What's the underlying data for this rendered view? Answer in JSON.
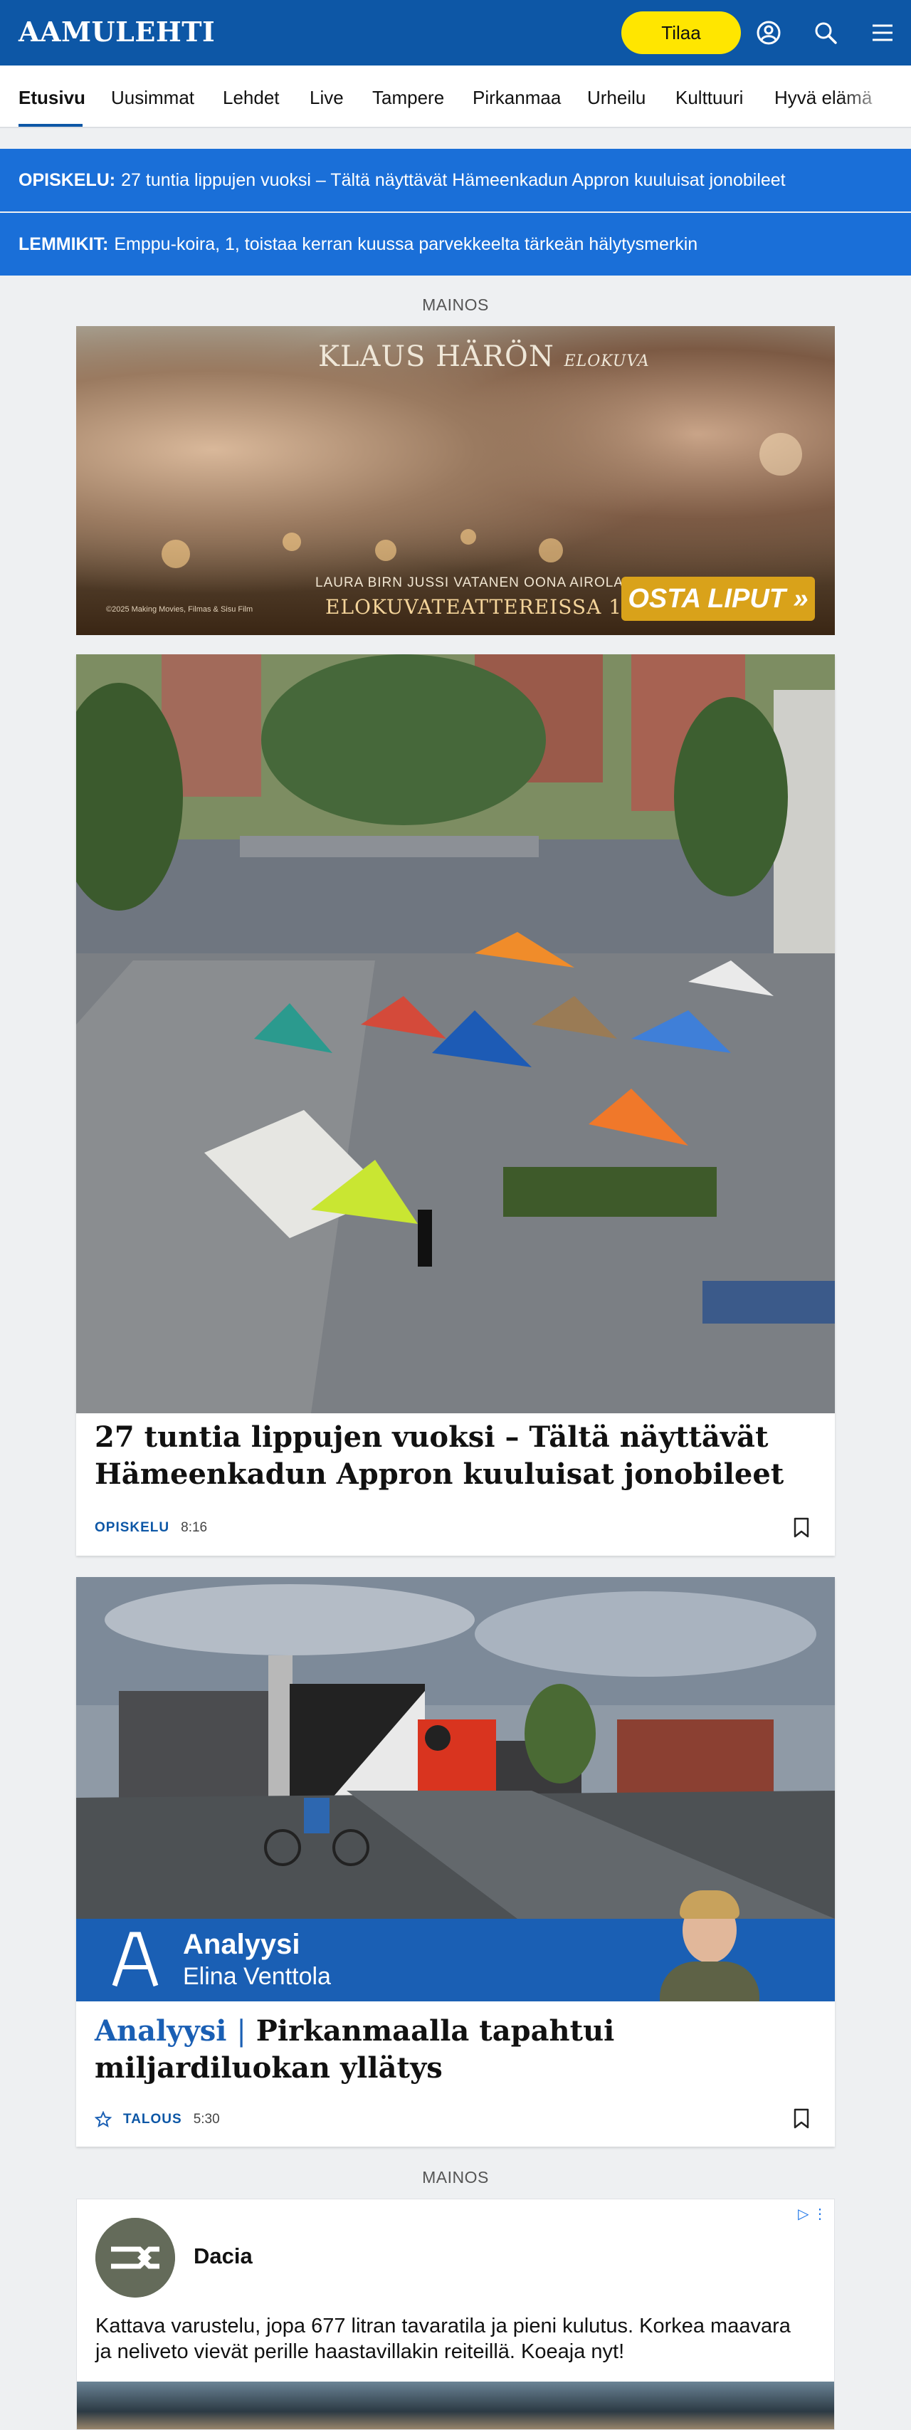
{
  "header": {
    "logo": "AAMULEHTI",
    "subscribe_label": "Tilaa",
    "icons": [
      "user-icon",
      "search-icon",
      "menu-icon"
    ]
  },
  "nav": {
    "items": [
      "Etusivu",
      "Uusimmat",
      "Lehdet",
      "Live",
      "Tampere",
      "Pirkanmaa",
      "Urheilu",
      "Kulttuuri",
      "Hyvä elämä"
    ],
    "active": "Etusivu"
  },
  "banners": [
    {
      "label": "OPISKELU:",
      "text": "27 tuntia lippujen vuoksi – Tältä näyttävät Hämeenkadun Appron kuuluisat jonobileet"
    },
    {
      "label": "LEMMIKIT:",
      "text": "Emppu-koira, 1, toistaa kerran kuussa parvekkeelta tärkeän hälytysmerkin"
    }
  ],
  "ads": {
    "label": "MAINOS",
    "movie": {
      "title": "KLAUS HÄRÖN",
      "title_suffix": "ELOKUVA",
      "cast": "LAURA BIRN   JUSSI VATANEN   OONA AIROLA",
      "release": "ELOKUVATEATTEREISSA 11.9.",
      "cta": "OSTA LIPUT »",
      "copyright": "©2025 Making Movies, Filmas & Sisu Film"
    },
    "dacia": {
      "brand": "Dacia",
      "text": "Kattava varustelu, jopa 677 litran tavaratila ja pieni kulutus. Korkea maavara ja neliveto vievät perille haastavillakin reiteillä. Koeaja nyt!"
    }
  },
  "articles": [
    {
      "headline": "27 tuntia lippujen vuoksi – Tältä näyttävät Hämeenkadun Appron kuuluisat jonobileet",
      "category": "OPISKELU",
      "time": "8:16"
    },
    {
      "kicker": "Analyysi",
      "kicker_separator": "|",
      "headline": "Pirkanmaalla tapahtui miljardiluokan yllätys",
      "category": "TALOUS",
      "time": "5:30",
      "badge_title": "Analyysi",
      "badge_author": "Elina Venttola"
    }
  ],
  "colors": {
    "brand_blue": "#0d57a6",
    "banner_blue": "#1a6fd8",
    "subscribe_yellow": "#ffe600"
  }
}
